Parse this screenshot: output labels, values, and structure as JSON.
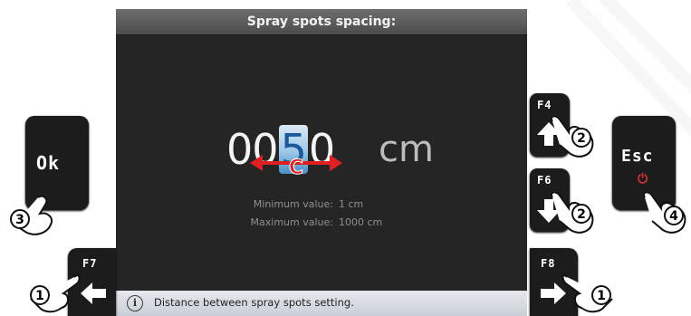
{
  "screen": {
    "title": "Spray spots spacing:",
    "value": {
      "digit1": "0",
      "digit2": "0",
      "digit_selected": "5",
      "digit4": "0",
      "unit": "cm"
    },
    "cursor_label": "C",
    "min_label": "Minimum value:",
    "min_value": "1 cm",
    "max_label": "Maximum value:",
    "max_value": "1000 cm",
    "info_text": "Distance between spray spots setting."
  },
  "keys": {
    "ok": {
      "label": "Ok",
      "step": "3"
    },
    "esc": {
      "label": "Esc",
      "step": "4"
    },
    "f4": {
      "label": "F4",
      "step": "2"
    },
    "f6": {
      "label": "F6",
      "step": "2"
    },
    "f7": {
      "label": "F7",
      "step": "1"
    },
    "f8": {
      "label": "F8",
      "step": "1"
    }
  },
  "colors": {
    "accent_arrow": "#e02020",
    "selected_digit": "#4b8fc4",
    "power_icon": "#e03030"
  }
}
